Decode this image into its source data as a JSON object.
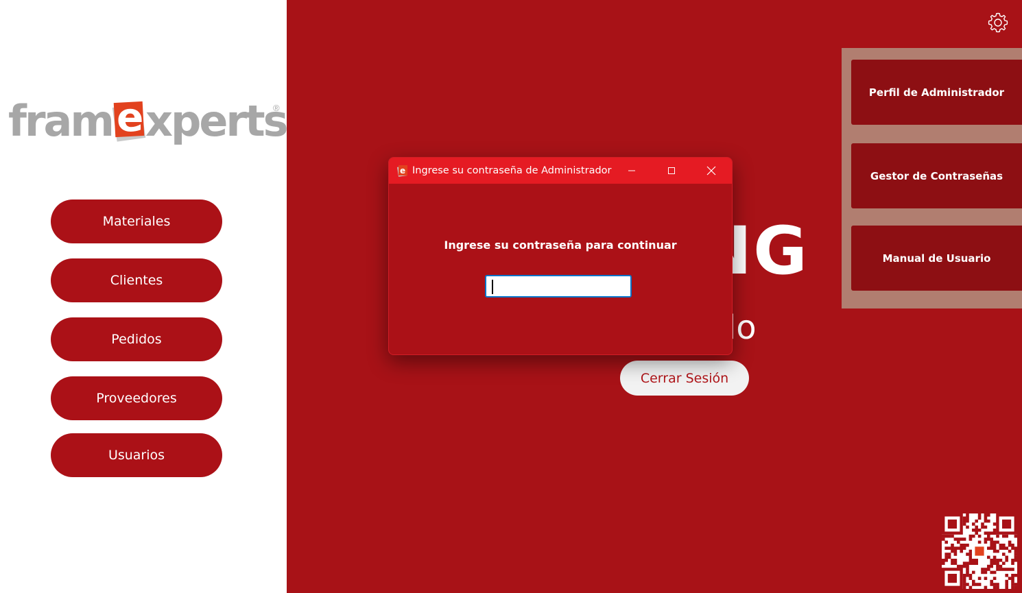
{
  "brand": {
    "logo_prefix": "fram",
    "logo_e": "e",
    "logo_suffix": "xperts",
    "registered": "®"
  },
  "sidebar": {
    "items": [
      {
        "label": "Materiales"
      },
      {
        "label": "Clientes"
      },
      {
        "label": "Pedidos"
      },
      {
        "label": "Proveedores"
      },
      {
        "label": "Usuarios"
      }
    ]
  },
  "main": {
    "headline_partial": "ING",
    "subtitle_partial": "e do",
    "logout_label": "Cerrar Sesión",
    "settings_icon": "gear-icon"
  },
  "admin_menu": {
    "items": [
      {
        "label": "Perfil de Administrador"
      },
      {
        "label": "Gestor de Contraseñas"
      },
      {
        "label": "Manual de Usuario"
      }
    ]
  },
  "dialog": {
    "title": "Ingrese su contraseña de Administrador",
    "prompt": "Ingrese su contraseña para continuar",
    "password_value": ""
  },
  "colors": {
    "brand_red": "#a81217",
    "nav_red": "#ab1117",
    "titlebar_red": "#e51b23",
    "admin_btn": "#8d0f13",
    "admin_panel": "#b17e70",
    "logo_gray": "#a7a7a7",
    "logo_orange": "#e2421e"
  }
}
